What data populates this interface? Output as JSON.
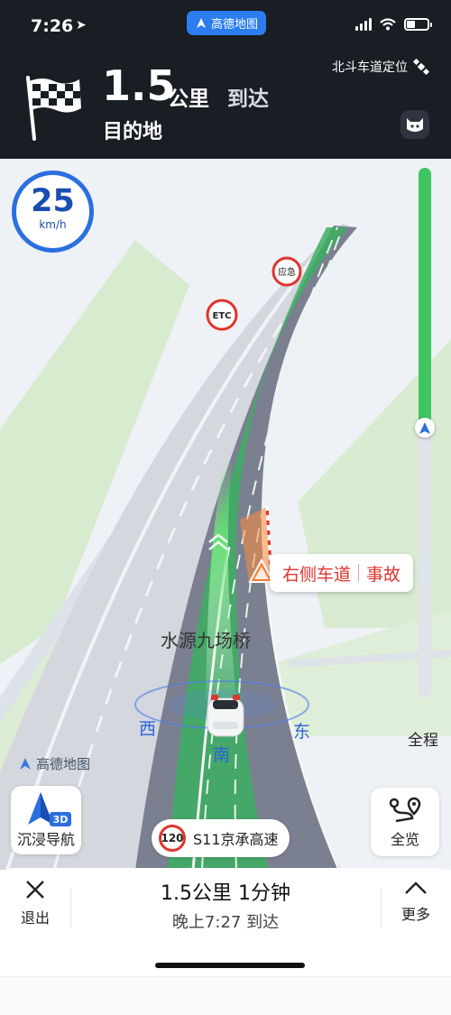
{
  "status_bar": {
    "time": "7:26",
    "app_badge": "高德地图"
  },
  "nav": {
    "distance_value": "1.5",
    "distance_unit": "公里",
    "action": "到达",
    "destination": "目的地",
    "lane_positioning": "北斗车道定位"
  },
  "map": {
    "speed": {
      "value": "25",
      "unit": "km/h"
    },
    "signs": {
      "etc": "ETC",
      "emergency": "应急"
    },
    "incident": {
      "lane": "右侧车道",
      "type": "事故"
    },
    "road_name": "水源九场桥",
    "compass": {
      "west": "西",
      "south": "南",
      "east": "东"
    },
    "watermark": "高德地图",
    "route_progress": 0.49,
    "full_route_label": "全程",
    "immersive_button": {
      "label": "沉浸导航",
      "badge": "3D"
    },
    "overview_button": {
      "label": "全览"
    },
    "current_road": {
      "speed_limit": "120",
      "name": "S11京承高速"
    }
  },
  "bottom": {
    "exit_label": "退出",
    "summary_main": "1.5公里 1分钟",
    "summary_sub": "晚上7:27 到达",
    "more_label": "更多"
  },
  "colors": {
    "header_bg": "#191d24",
    "route_green": "#3fc562",
    "speed_blue": "#2b6fe0",
    "incident_red": "#e0342d",
    "app_blue": "#2b7df1"
  }
}
